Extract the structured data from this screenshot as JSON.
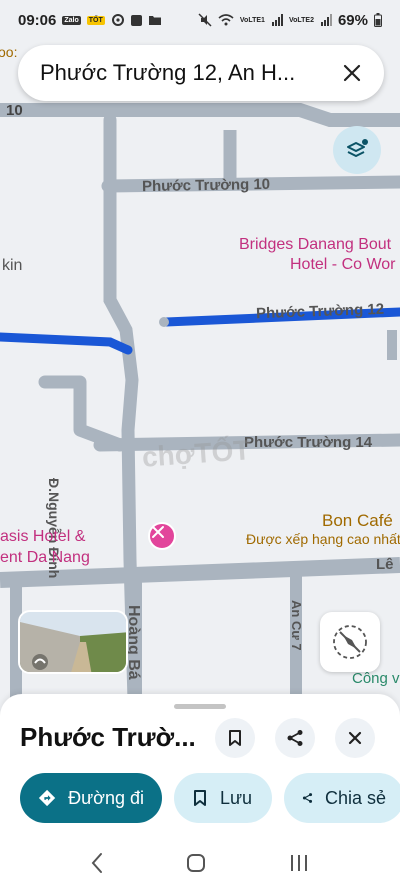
{
  "status_bar": {
    "time": "09:06",
    "app_badges": [
      "Zalo",
      "TỐT"
    ],
    "battery_percent": "69%",
    "network_labels": [
      "VoLTE1",
      "VoLTE2"
    ]
  },
  "search": {
    "query": "Phước Trường 12, An H..."
  },
  "map": {
    "roads": {
      "phuoc_truong_10": "Phước Trường 10",
      "phuoc_truong_12": "Phước Trường 12",
      "phuoc_truong_14": "Phước Trường 14",
      "nguyen_dinh": "Đ.Nguyễn Đình",
      "hoang_bao": "Hoàng Bá",
      "an_cu_7": "An Cư 7",
      "le": "Lê",
      "top_left_10": "10"
    },
    "pois": {
      "bridges_line1": "Bridges Danang Bout",
      "bridges_line2": "Hotel - Co Wor",
      "bon_cafe": "Bon Café",
      "bon_cafe_sub": "Được xếp hạng cao nhất",
      "oasis_line1": "asis Hotel &",
      "oasis_line2": "ent Da Nang",
      "kin": "kin",
      "cong": "Công v",
      "top_left_poi": "oo:",
      "watermark": "chợTỐT"
    },
    "route_color": "#1a57d6"
  },
  "sheet": {
    "title": "Phước Trườ...",
    "actions": {
      "directions": "Đường đi",
      "save": "Lưu",
      "share": "Chia sẻ"
    }
  },
  "colors": {
    "primary": "#0b7187",
    "secondary": "#d6eef6",
    "poi": "#c2307f",
    "cafe": "#a06a00"
  }
}
